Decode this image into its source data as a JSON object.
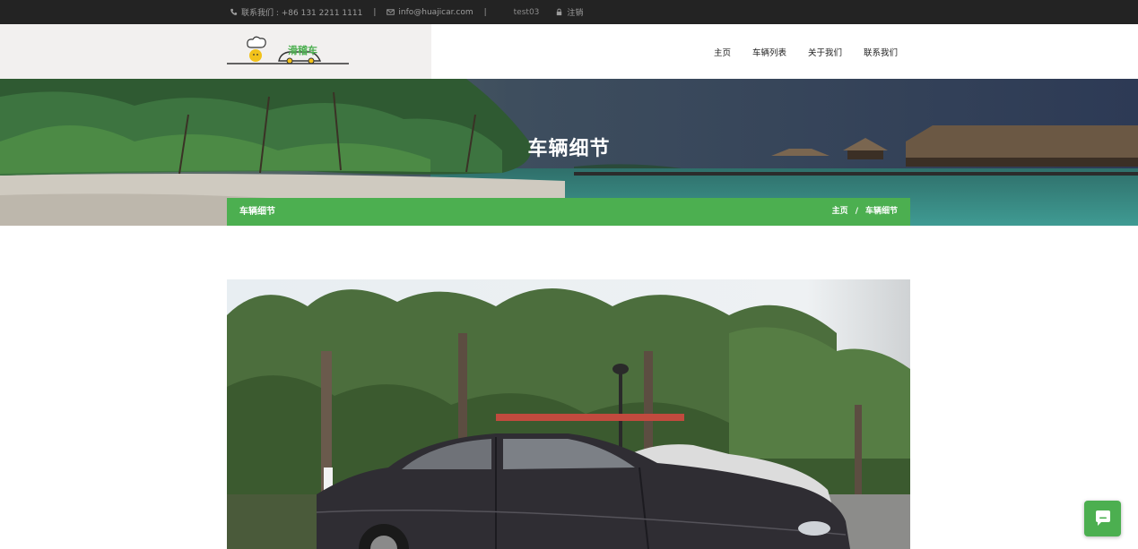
{
  "topbar": {
    "phone_text": "联系我们 : +86 131 2211 1111",
    "separator": "|",
    "email_text": "info@huajicar.com",
    "user_text": "test03",
    "logout_text": "注销"
  },
  "header": {
    "logo_text": "滑稽车",
    "nav": [
      "主页",
      "车辆列表",
      "关于我们",
      "联系我们"
    ]
  },
  "banner": {
    "title": "车辆细节",
    "bar_title": "车辆细节",
    "breadcrumb_home": "主页",
    "breadcrumb_sep": "/",
    "breadcrumb_current": "车辆细节"
  },
  "colors": {
    "accent": "#4caf50",
    "topbar_bg": "#232323"
  },
  "icons": {
    "phone": "phone-icon",
    "email": "envelope-icon",
    "logout": "lock-icon",
    "chat": "chat-icon"
  }
}
